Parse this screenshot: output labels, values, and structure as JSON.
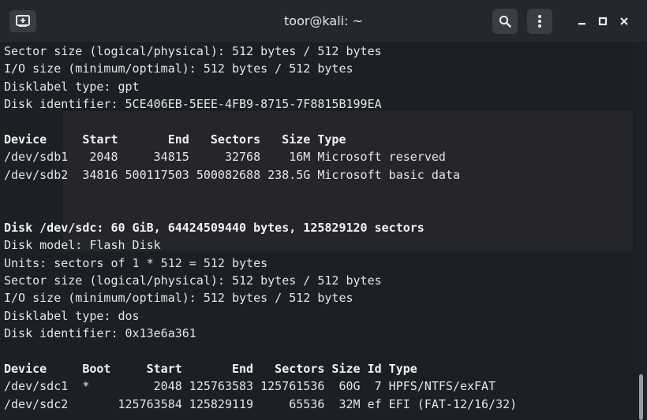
{
  "window": {
    "title": "toor@kali: ~"
  },
  "icons": {
    "new_tab": "new-tab-icon",
    "search": "search-icon",
    "menu": "kebab-menu-icon",
    "minimize": "minimize-icon",
    "maximize": "maximize-icon",
    "close": "close-icon"
  },
  "terminal": {
    "lines": [
      {
        "text": "Sector size (logical/physical): 512 bytes / 512 bytes",
        "bold": false
      },
      {
        "text": "I/O size (minimum/optimal): 512 bytes / 512 bytes",
        "bold": false
      },
      {
        "text": "Disklabel type: gpt",
        "bold": false
      },
      {
        "text": "Disk identifier: 5CE406EB-5EEE-4FB9-8715-7F8815B199EA",
        "bold": false
      },
      {
        "text": "",
        "bold": false
      },
      {
        "text": "Device     Start       End   Sectors   Size Type",
        "bold": true
      },
      {
        "text": "/dev/sdb1   2048     34815     32768    16M Microsoft reserved",
        "bold": false
      },
      {
        "text": "/dev/sdb2  34816 500117503 500082688 238.5G Microsoft basic data",
        "bold": false
      },
      {
        "text": "",
        "bold": false
      },
      {
        "text": "",
        "bold": false
      },
      {
        "text": "Disk /dev/sdc: 60 GiB, 64424509440 bytes, 125829120 sectors",
        "bold": true
      },
      {
        "text": "Disk model: Flash Disk",
        "bold": false
      },
      {
        "text": "Units: sectors of 1 * 512 = 512 bytes",
        "bold": false
      },
      {
        "text": "Sector size (logical/physical): 512 bytes / 512 bytes",
        "bold": false
      },
      {
        "text": "I/O size (minimum/optimal): 512 bytes / 512 bytes",
        "bold": false
      },
      {
        "text": "Disklabel type: dos",
        "bold": false
      },
      {
        "text": "Disk identifier: 0x13e6a361",
        "bold": false
      },
      {
        "text": "",
        "bold": false
      },
      {
        "text": "Device     Boot     Start       End   Sectors Size Id Type",
        "bold": true
      },
      {
        "text": "/dev/sdc1  *         2048 125763583 125761536  60G  7 HPFS/NTFS/exFAT",
        "bold": false
      },
      {
        "text": "/dev/sdc2       125763584 125829119     65536  32M ef EFI (FAT-12/16/32)",
        "bold": false
      }
    ]
  }
}
